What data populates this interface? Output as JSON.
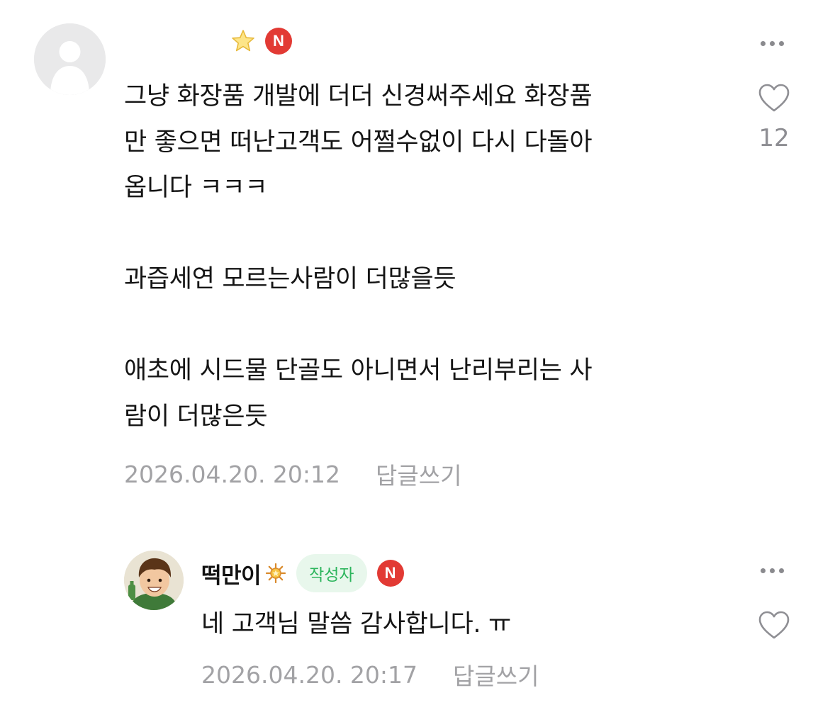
{
  "comments": [
    {
      "author": "",
      "badge": "N",
      "lines": [
        "그냥 화장품 개발에 더더 신경써주세요 화장품",
        "만 좋으면 떠난고객도 어쩔수없이 다시 다돌아",
        "옵니다 ㅋㅋㅋ",
        "",
        "과즙세연 모르는사람이 더많을듯",
        "",
        "애초에 시드물 단골도 아니면서 난리부리는 사",
        "람이 더많은듯"
      ],
      "timestamp": "2026.04.20. 20:12",
      "reply_label": "답글쓰기",
      "like_count": "12"
    },
    {
      "author": "떡만이",
      "writer_label": "작성자",
      "badge": "N",
      "lines": [
        "네 고객님 말씀 감사합니다. ㅠ"
      ],
      "timestamp": "2026.04.20. 20:17",
      "reply_label": "답글쓰기",
      "like_count": ""
    }
  ],
  "colors": {
    "badge_red": "#e23a34",
    "writer_green": "#2db55d",
    "meta_gray": "#a2a2a5"
  },
  "icons": {
    "star": "star-icon",
    "more": "more-icon",
    "like": "heart-icon",
    "rank": "rank-icon"
  }
}
